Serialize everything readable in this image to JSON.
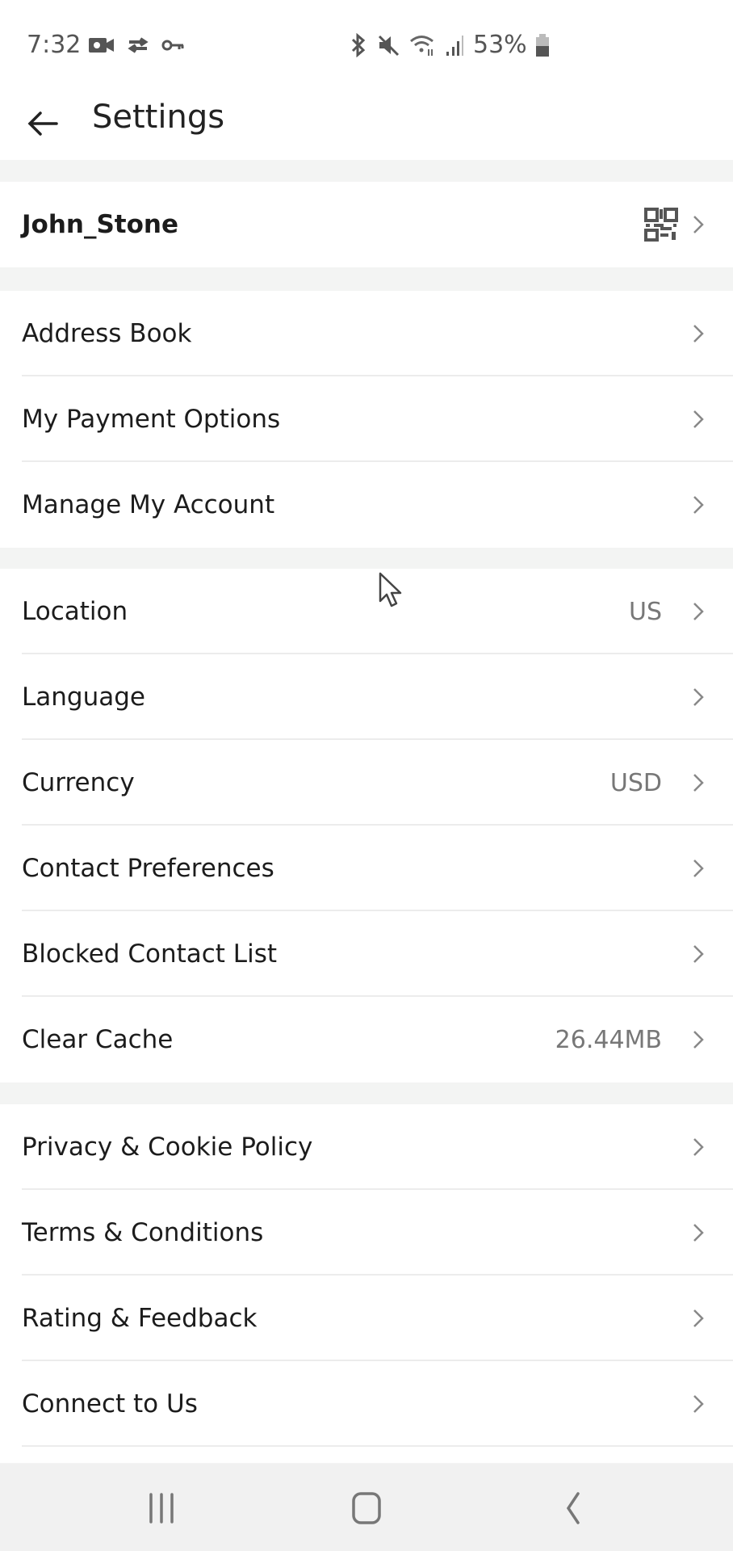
{
  "status_bar": {
    "time": "7:32",
    "left_icons": [
      "video-record-icon",
      "sync-check-icon",
      "key-icon"
    ],
    "right_icons": [
      "bluetooth-icon",
      "mute-icon",
      "wifi-icon",
      "signal-icon"
    ],
    "battery_percent": "53%",
    "battery_level": 0.53
  },
  "header": {
    "back_icon": "arrow-left-icon",
    "title": "Settings"
  },
  "profile": {
    "username": "John_Stone",
    "qr_icon": "qr-code-icon"
  },
  "sections": [
    {
      "items": [
        {
          "label": "Address Book",
          "value": ""
        },
        {
          "label": "My Payment Options",
          "value": ""
        },
        {
          "label": "Manage My Account",
          "value": ""
        }
      ]
    },
    {
      "items": [
        {
          "label": "Location",
          "value": "US"
        },
        {
          "label": "Language",
          "value": ""
        },
        {
          "label": "Currency",
          "value": "USD"
        },
        {
          "label": "Contact Preferences",
          "value": ""
        },
        {
          "label": "Blocked Contact List",
          "value": ""
        },
        {
          "label": "Clear Cache",
          "value": "26.44MB"
        }
      ]
    },
    {
      "items": [
        {
          "label": "Privacy & Cookie Policy",
          "value": ""
        },
        {
          "label": "Terms & Conditions",
          "value": ""
        },
        {
          "label": "Rating & Feedback",
          "value": ""
        },
        {
          "label": "Connect to Us",
          "value": ""
        }
      ]
    }
  ],
  "nav_bar": {
    "buttons": [
      "recent-apps",
      "home",
      "back"
    ]
  }
}
